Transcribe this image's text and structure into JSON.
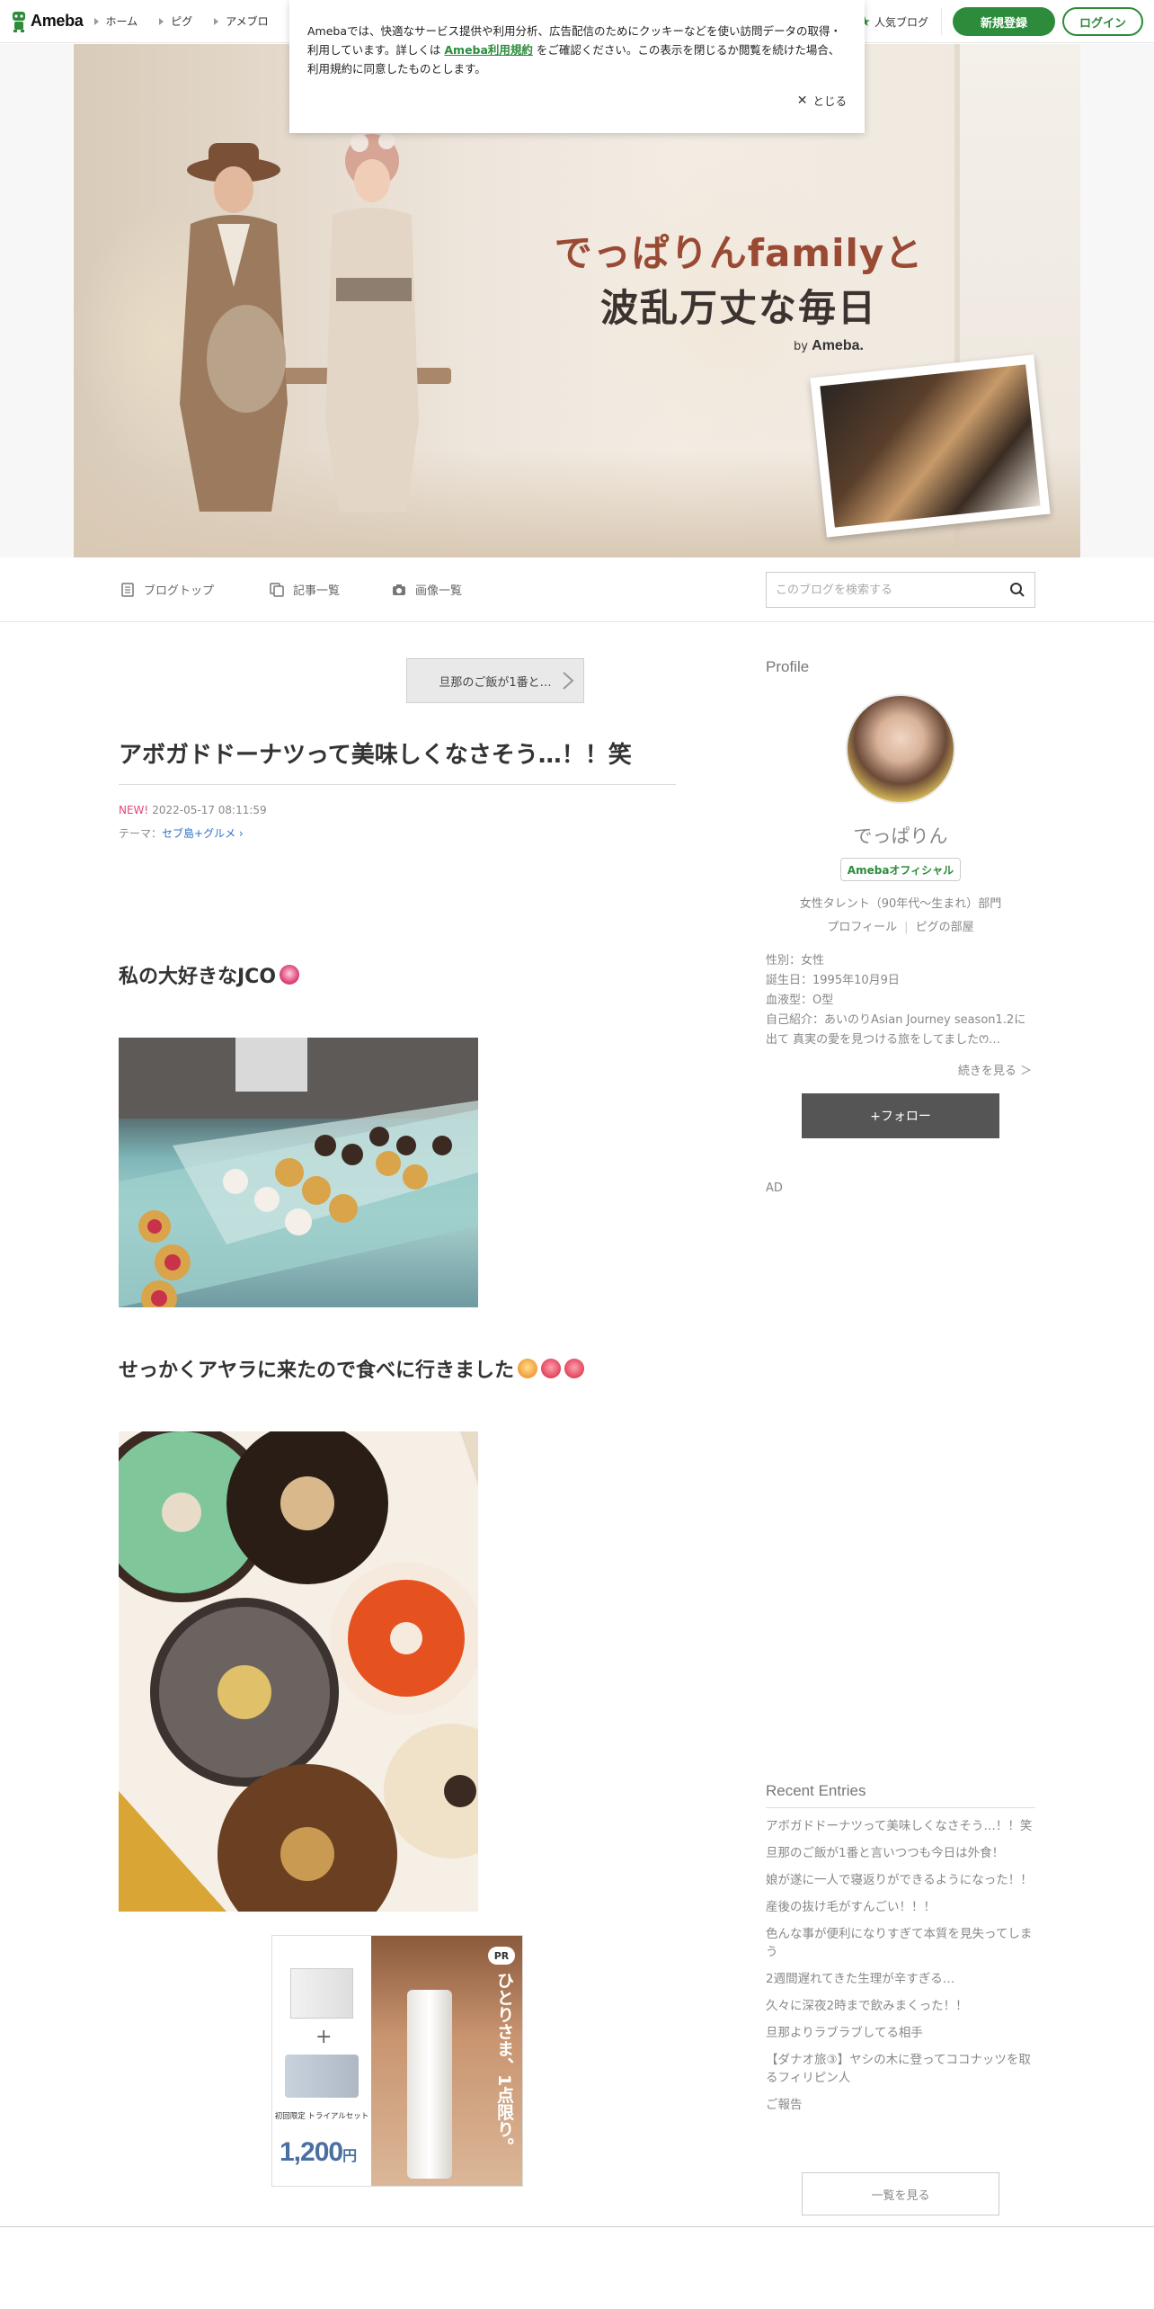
{
  "topnav": {
    "logo": "Ameba",
    "links": [
      "ホーム",
      "ピグ",
      "アメブロ"
    ],
    "popular": "人気ブログ",
    "signup": "新規登録",
    "login": "ログイン"
  },
  "cookie": {
    "text_before": "Amebaでは、快適なサービス提供や利用分析、広告配信のためにクッキーなどを使い訪問データの取得・利用しています。詳しくは",
    "link": "Ameba利用規約",
    "text_after": "をご確認ください。この表示を閉じるか閲覧を続けた場合、利用規約に同意したものとします。",
    "close": "とじる"
  },
  "banner": {
    "title_line1": "でっぱりんfamilyと",
    "title_line2": "波乱万丈な毎日",
    "by": "by",
    "brand": "Ameba."
  },
  "blognav": {
    "top": "ブログトップ",
    "entries": "記事一覧",
    "images": "画像一覧",
    "search_placeholder": "このブログを検索する"
  },
  "article": {
    "prev": "旦那のご飯が1番と…",
    "title": "アボガドドーナツって美味しくなさそう…！！笑",
    "new_label": "NEW!",
    "date": "2022-05-17 08:11:59",
    "theme_label": "テーマ：",
    "theme": "セブ島+グルメ",
    "heading1": "私の大好きなJCO",
    "heading2": "せっかくアヤラに来たので食べに行きました",
    "ad": {
      "pr": "PR",
      "vertical": "ひとりさま、1点限り。",
      "trial": "初回限定 トライアルセット",
      "price": "1,200",
      "yen": "円"
    }
  },
  "sidebar": {
    "profile_heading": "Profile",
    "name": "でっぱりん",
    "official": "Amebaオフィシャル",
    "category": "女性タレント（90年代～生まれ）部門",
    "link_profile": "プロフィール",
    "link_pig": "ピグの部屋",
    "info": [
      "性別：女性",
      "誕生日：1995年10月9日",
      "血液型：O型",
      "自己紹介：あいのりAsian Journey season1.2に出て 真実の愛を見つける旅をしてましたꯁ…"
    ],
    "more": "続きを見る ＞",
    "follow": "+フォロー",
    "ad": "AD",
    "recent_heading": "Recent Entries",
    "recent": [
      "アボガドドーナツって美味しくなさそう…！！笑",
      "旦那のご飯が1番と言いつつも今日は外食！",
      "娘が遂に一人で寝返りができるようになった！！",
      "産後の抜け毛がすんごい！！！",
      "色んな事が便利になりすぎて本質を見失ってしまう",
      "2週間遅れてきた生理が辛すぎる…",
      "久々に深夜2時まで飲みまくった！！",
      "旦那よりラブラブしてる相手",
      "【ダナオ旅③】ヤシの木に登ってココナッツを取るフィリピン人",
      "ご報告"
    ],
    "recent_all": "一覧を見る"
  },
  "colors": {
    "brand_green": "#2d8c3c",
    "new_pink": "#e0457b",
    "theme_blue": "#2f73c5"
  }
}
